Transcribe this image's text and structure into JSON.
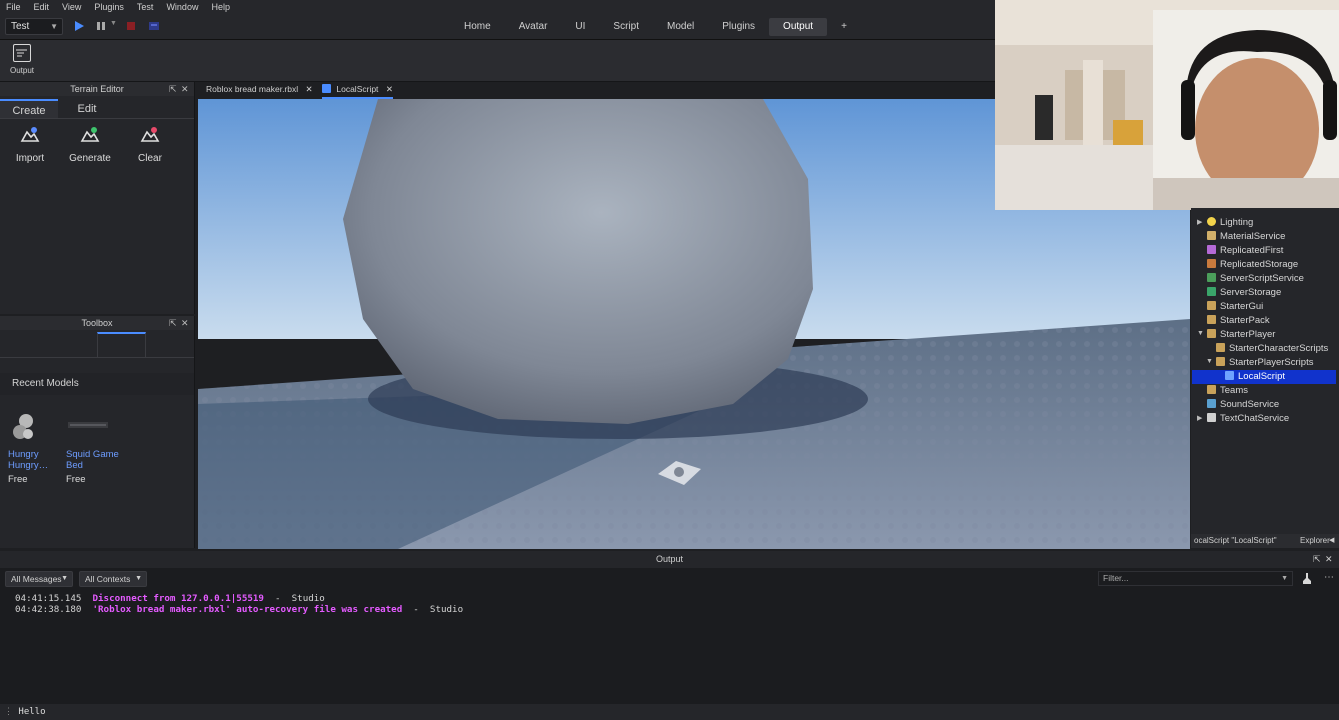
{
  "menu": [
    "File",
    "Edit",
    "View",
    "Plugins",
    "Test",
    "Window",
    "Help"
  ],
  "toolbar": {
    "mode_select": "Test"
  },
  "tabs": [
    {
      "label": "Home",
      "active": false
    },
    {
      "label": "Avatar",
      "active": false
    },
    {
      "label": "UI",
      "active": false
    },
    {
      "label": "Script",
      "active": false
    },
    {
      "label": "Model",
      "active": false
    },
    {
      "label": "Plugins",
      "active": false
    },
    {
      "label": "Output",
      "active": true
    },
    {
      "label": "+",
      "active": false
    }
  ],
  "ribbon": {
    "output_label": "Output"
  },
  "terrain": {
    "title": "Terrain Editor",
    "tabs": [
      "Create",
      "Edit"
    ],
    "tools": [
      "Import",
      "Generate",
      "Clear"
    ]
  },
  "toolbox": {
    "title": "Toolbox",
    "section": "Recent Models",
    "models": [
      {
        "name": "Hungry Hungry…",
        "name_line1": "Hungry",
        "name_line2": "Hungry…",
        "price": "Free"
      },
      {
        "name": "Squid Game Bed",
        "name_line1": "Squid Game",
        "name_line2": "Bed",
        "price": "Free"
      }
    ]
  },
  "doc_tabs": [
    "Roblox bread maker.rbxl",
    "LocalScript"
  ],
  "explorer": {
    "items": [
      "Lighting",
      "MaterialService",
      "ReplicatedFirst",
      "ReplicatedStorage",
      "ServerScriptService",
      "ServerStorage",
      "StarterGui",
      "StarterPack",
      "StarterPlayer",
      "StarterCharacterScripts",
      "StarterPlayerScripts",
      "LocalScript",
      "Teams",
      "SoundService",
      "TextChatService"
    ],
    "status": "ocalScript \"LocalScript\"",
    "tab": "Explorer"
  },
  "output": {
    "title": "Output",
    "filter_messages": "All Messages",
    "filter_contexts": "All Contexts",
    "filter_placeholder": "Filter...",
    "logs": [
      {
        "time": "04:41:15.145",
        "message": "Disconnect from 127.0.0.1|55519",
        "source": "Studio"
      },
      {
        "time": "04:42:38.180",
        "message": "'Roblox bread maker.rbxl' auto-recovery file was created",
        "source": "Studio"
      }
    ],
    "command": "Hello"
  },
  "colors": {
    "accent": "#4a8cff",
    "selection": "#1133cc",
    "log_message": "#e45bff",
    "link": "#6d9cff"
  }
}
